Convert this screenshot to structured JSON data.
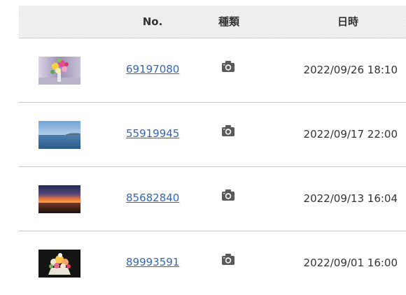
{
  "header": {
    "no_label": "No.",
    "type_label": "種類",
    "date_label": "日時"
  },
  "rows": [
    {
      "id": "69197080",
      "type_icon": "camera-icon",
      "datetime": "2022/09/26 18:10",
      "thumbnail": "flower-bouquet-image"
    },
    {
      "id": "55919945",
      "type_icon": "camera-icon",
      "datetime": "2022/09/17 22:00",
      "thumbnail": "sea-horizon-image"
    },
    {
      "id": "85682840",
      "type_icon": "camera-icon",
      "datetime": "2022/09/13 16:04",
      "thumbnail": "sunset-sea-image"
    },
    {
      "id": "89993591",
      "type_icon": "camera-icon",
      "datetime": "2022/09/01 16:00",
      "thumbnail": "flower-arrangement-image"
    }
  ],
  "colors": {
    "link": "#3366bb",
    "header_bg": "#ececec",
    "text": "#333333",
    "divider": "#c8c8c8"
  }
}
